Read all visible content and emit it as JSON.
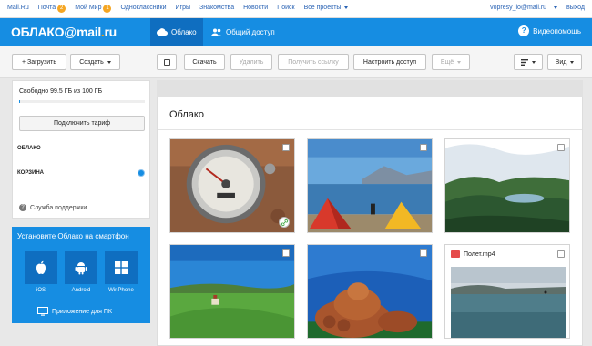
{
  "portal": {
    "links": [
      "Mail.Ru",
      "Почта",
      "Мой Мир",
      "Одноклассники",
      "Игры",
      "Знакомства",
      "Новости",
      "Поиск",
      "Все проекты"
    ],
    "mail_badge": "2",
    "myworld_badge": "1",
    "user_email": "vopresy_lo@mail.ru",
    "logout": "выход"
  },
  "header": {
    "logo_text": "ОБЛАКО",
    "logo_at": "@",
    "logo_mail": "mail",
    "logo_dot": ".",
    "logo_ru": "ru",
    "tab_cloud": "Облако",
    "tab_shared": "Общий доступ",
    "help": "Видеопомощь",
    "help_mark": "?"
  },
  "toolbar": {
    "upload": "+ Загрузить",
    "create": "Создать",
    "download": "Скачать",
    "delete": "Удалить",
    "get_link": "Получить ссылку",
    "configure_access": "Настроить доступ",
    "more": "Ещё",
    "view": "Вид"
  },
  "sidebar": {
    "quota_text": "Свободно 99.5 ГБ из 100 ГБ",
    "quota_used_fraction": 0.005,
    "connect_tariff": "Подключить тариф",
    "folder_cloud": "ОБЛАКО",
    "folder_trash": "КОРЗИНА",
    "support": "Служба поддержки",
    "support_mark": "?"
  },
  "promo": {
    "title": "Установите Облако на смартфон",
    "platforms": [
      "iOS",
      "Android",
      "WinPhone"
    ],
    "pc_app": "Приложение для ПК"
  },
  "main": {
    "title": "Облако",
    "video_name": "Полет.mp4"
  }
}
